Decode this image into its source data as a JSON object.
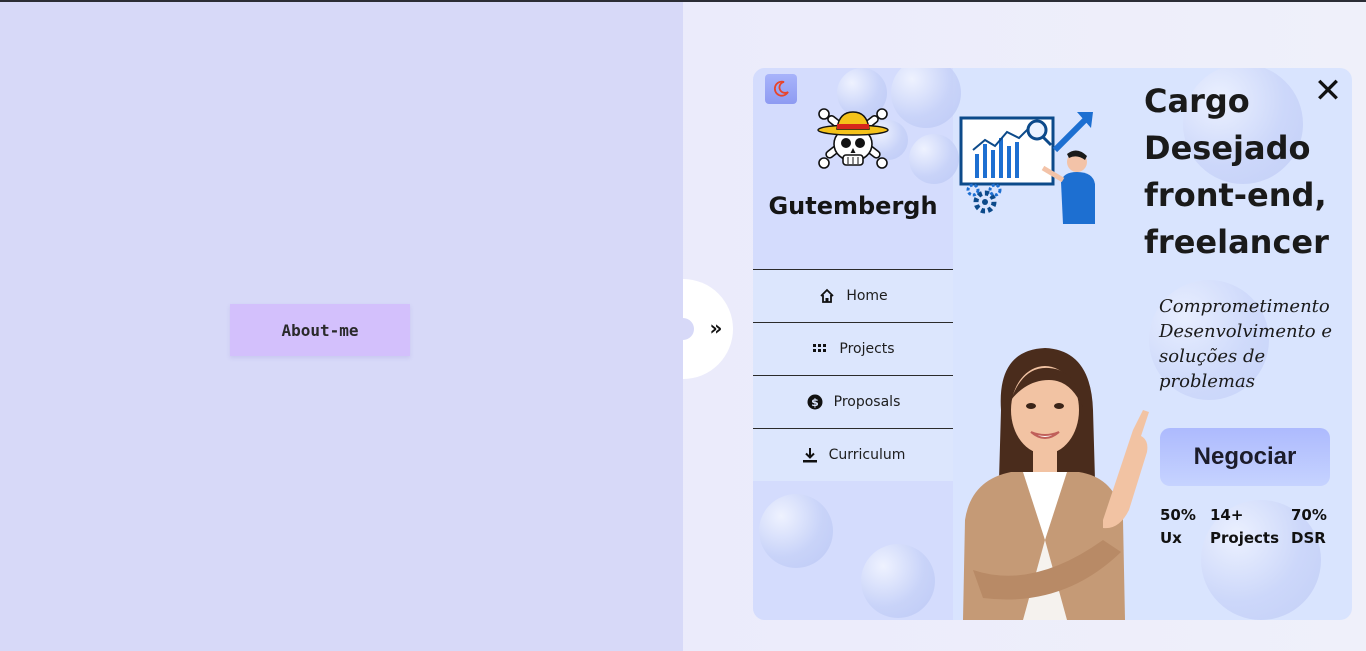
{
  "about_button": "About-me",
  "profile": {
    "name": "Gutembergh",
    "theme_icon": "moon-icon",
    "logo": "straw-hat-skull-logo"
  },
  "nav": [
    {
      "label": "Home",
      "icon": "home-icon"
    },
    {
      "label": "Projects",
      "icon": "grid-icon"
    },
    {
      "label": "Proposals",
      "icon": "dollar-badge-icon"
    },
    {
      "label": "Curriculum",
      "icon": "download-icon"
    }
  ],
  "hero": {
    "title_lines": [
      "Cargo",
      "Desejado",
      "front-end,",
      "freelancer"
    ],
    "description_lines": [
      "Comprometimento",
      "Desenvolvimento e",
      "soluções de",
      "problemas"
    ],
    "cta": "Negociar"
  },
  "stats": [
    {
      "value": "50%",
      "label": "Ux"
    },
    {
      "value": "14+",
      "label": "Projects"
    },
    {
      "value": "70%",
      "label": "DSR"
    }
  ],
  "colors": {
    "left_pane": "#d7d9f8",
    "about_button": "#d3c0fc",
    "card": "#d9e4fe",
    "cta": "#adbafe",
    "moon": "#e8452c"
  }
}
